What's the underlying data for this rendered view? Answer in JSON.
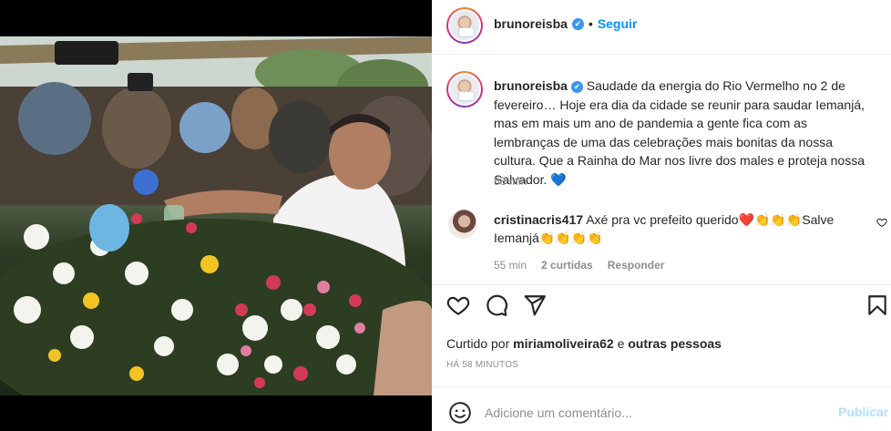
{
  "post": {
    "username": "brunoreisba",
    "follow_label": "Seguir",
    "separator": "•",
    "verified_mark": "✔"
  },
  "caption": {
    "username": "brunoreisba",
    "text": "Saudade da energia do Rio Vermelho no 2 de fevereiro… Hoje era dia da cidade se reunir para saudar Iemanjá, mas em mais um ano de pandemia a gente fica com as lembranças de uma das celebrações mais bonitas da nossa cultura. Que a Rainha do Mar nos livre dos males e proteja nossa Salvador.",
    "emoji": "💙",
    "time": "58 min"
  },
  "comment": {
    "username": "cristinacris417",
    "text_before": "Axé pra vc prefeito querido",
    "text_emojis_1": "❤️👏👏👏",
    "text_after": "Salve Iemanjá",
    "text_emojis_2": "👏👏👏👏",
    "time": "55 min",
    "likes": "2 curtidas",
    "reply_label": "Responder"
  },
  "likes": {
    "prefix": "Curtido por",
    "user": "miriamoliveira62",
    "middle": "e",
    "others": "outras pessoas"
  },
  "time_ago": "HÁ 58 MINUTOS",
  "add_comment": {
    "placeholder": "Adicione um comentário...",
    "publish_label": "Publicar"
  },
  "icons": {
    "like": "heart-icon",
    "comment": "comment-icon",
    "share": "share-icon",
    "save": "bookmark-icon",
    "emoji": "emoji-icon"
  },
  "colors": {
    "accent": "#0095f6",
    "publish_disabled": "#b2dffc",
    "verified": "#3897f0",
    "muted": "#8e8e8e"
  }
}
